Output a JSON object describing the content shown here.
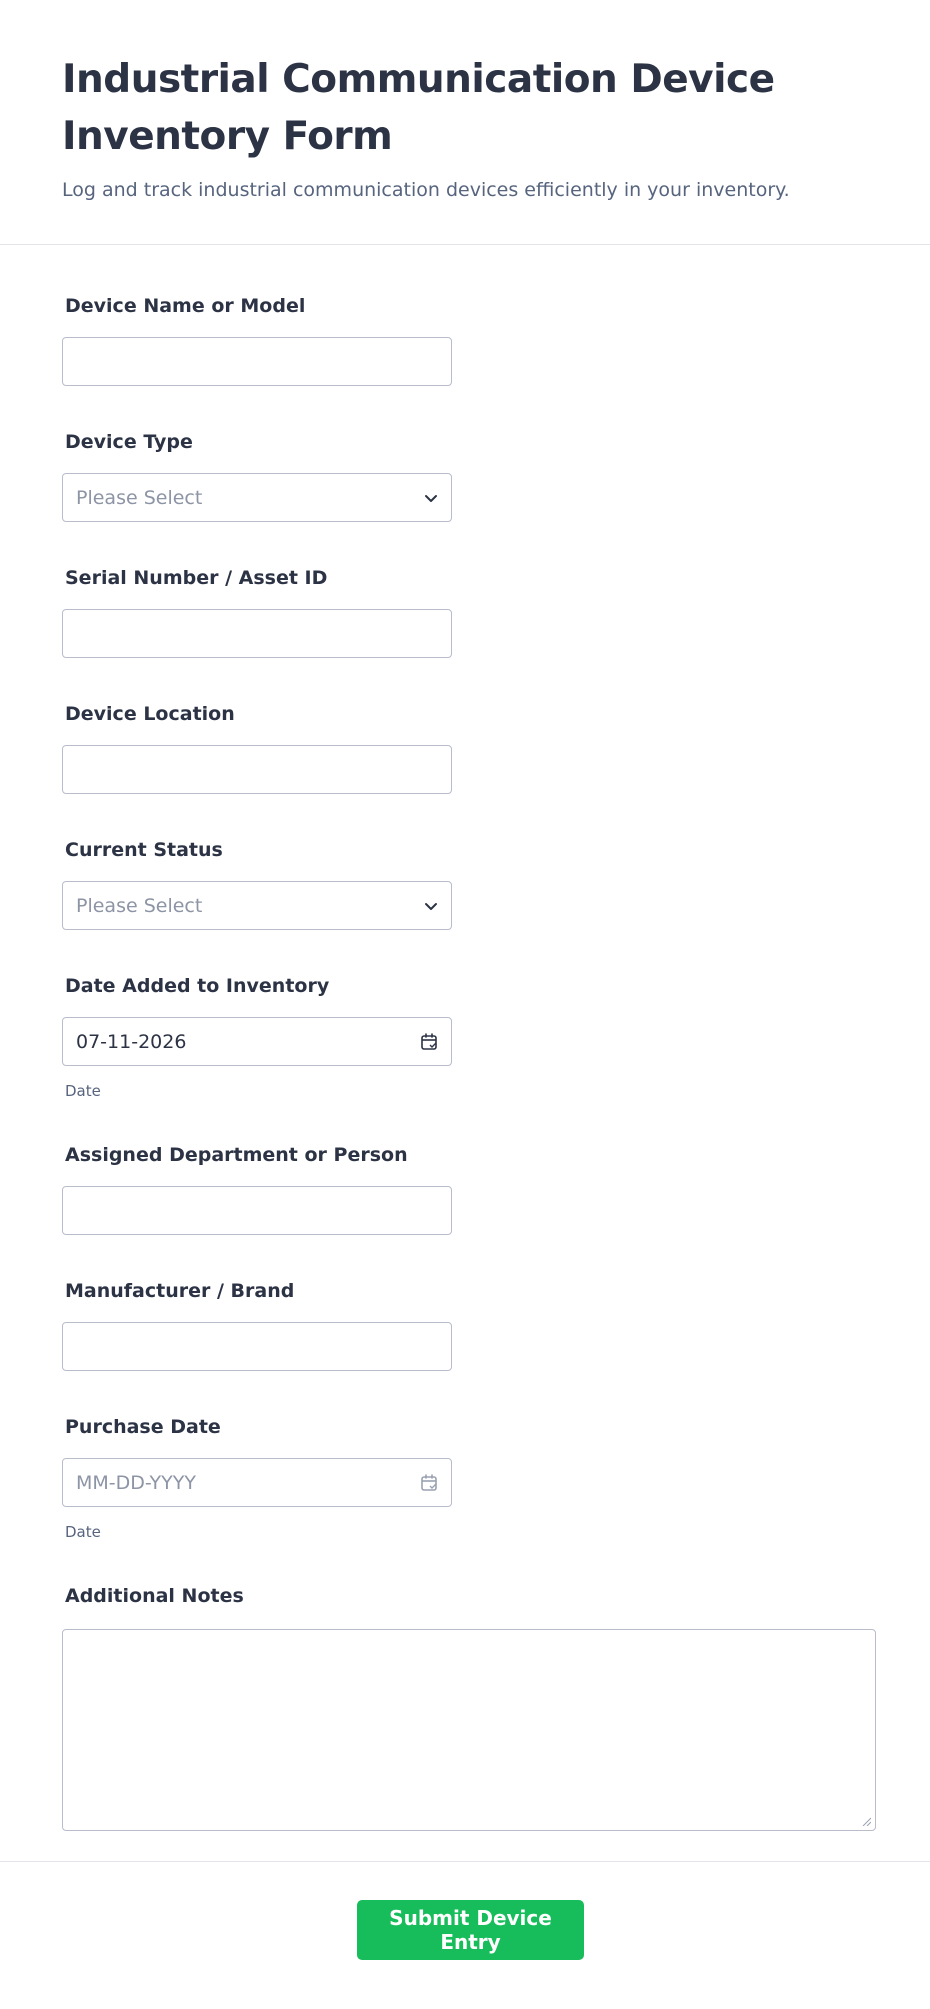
{
  "header": {
    "title": "Industrial Communication Device Inventory Form",
    "subtitle": "Log and track industrial communication devices efficiently in your inventory."
  },
  "fields": {
    "device_name": {
      "label": "Device Name or Model",
      "value": ""
    },
    "device_type": {
      "label": "Device Type",
      "placeholder": "Please Select"
    },
    "serial_number": {
      "label": "Serial Number / Asset ID",
      "value": ""
    },
    "device_location": {
      "label": "Device Location",
      "value": ""
    },
    "current_status": {
      "label": "Current Status",
      "placeholder": "Please Select"
    },
    "date_added": {
      "label": "Date Added to Inventory",
      "value": "07-11-2026",
      "sublabel": "Date"
    },
    "assigned": {
      "label": "Assigned Department or Person",
      "value": ""
    },
    "manufacturer": {
      "label": "Manufacturer / Brand",
      "value": ""
    },
    "purchase_date": {
      "label": "Purchase Date",
      "placeholder": "MM-DD-YYYY",
      "sublabel": "Date"
    },
    "notes": {
      "label": "Additional Notes",
      "value": ""
    }
  },
  "footer": {
    "submit_label": "Submit Device Entry"
  },
  "colors": {
    "accent": "#18bd5b",
    "text": "#2c3345",
    "muted": "#57647e",
    "border": "#b8bdc9"
  },
  "icons": {
    "select": "chevron-down-icon",
    "date": "calendar-icon"
  }
}
